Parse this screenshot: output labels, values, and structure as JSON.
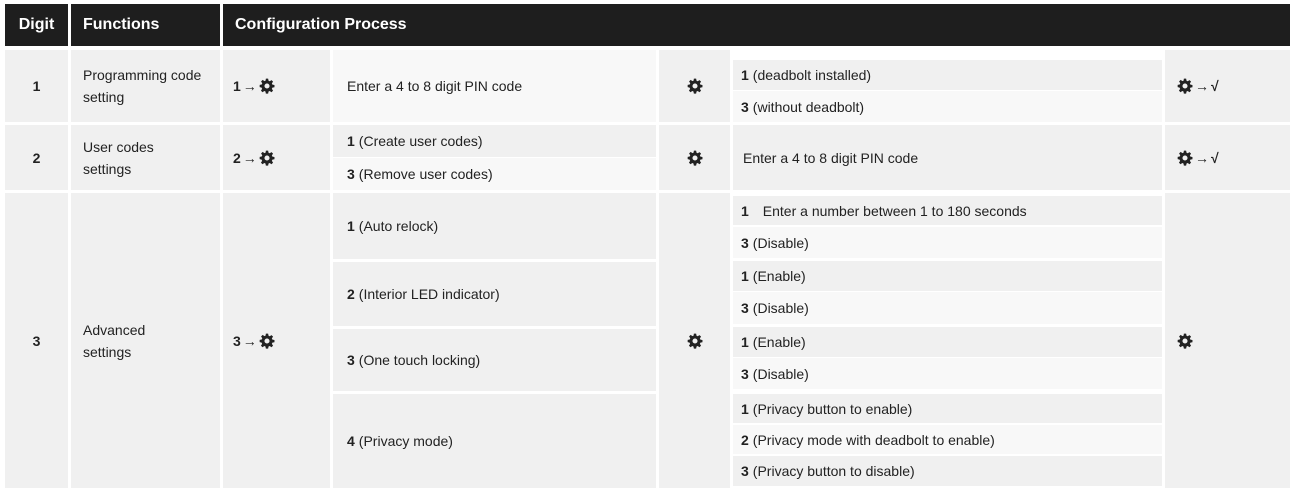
{
  "header": {
    "digit": "Digit",
    "functions": "Functions",
    "configuration": "Configuration Process"
  },
  "glyphs": {
    "arrow": "→",
    "check": "√"
  },
  "rows": [
    {
      "digit": "1",
      "function": "Programming code setting",
      "sequence": "1",
      "step1": "Enter a 4 to 8 digit PIN code",
      "options": [
        {
          "num": "1",
          "text": "(deadbolt installed)"
        },
        {
          "num": "3",
          "text": "(without deadbolt)"
        }
      ]
    },
    {
      "digit": "2",
      "function": "User codes settings",
      "sequence": "2",
      "step1_options": [
        {
          "num": "1",
          "text": "(Create user codes)"
        },
        {
          "num": "3",
          "text": "(Remove user codes)"
        }
      ],
      "step2": "Enter a 4 to 8 digit PIN code"
    },
    {
      "digit": "3",
      "function": "Advanced settings",
      "sequence": "3",
      "groups": [
        {
          "num": "1",
          "text": "(Auto relock)",
          "options": [
            {
              "num": "1",
              "text": "Enter a number between 1 to 180 seconds"
            },
            {
              "num": "3",
              "text": "(Disable)"
            }
          ]
        },
        {
          "num": "2",
          "text": "(Interior LED indicator)",
          "options": [
            {
              "num": "1",
              "text": "(Enable)"
            },
            {
              "num": "3",
              "text": "(Disable)"
            }
          ]
        },
        {
          "num": "3",
          "text": "(One touch locking)",
          "options": [
            {
              "num": "1",
              "text": "(Enable)"
            },
            {
              "num": "3",
              "text": "(Disable)"
            }
          ]
        },
        {
          "num": "4",
          "text": "(Privacy mode)",
          "options": [
            {
              "num": "1",
              "text": "(Privacy button to enable)"
            },
            {
              "num": "2",
              "text": "(Privacy mode with deadbolt to enable)"
            },
            {
              "num": "3",
              "text": "(Privacy button to disable)"
            }
          ]
        }
      ]
    }
  ]
}
